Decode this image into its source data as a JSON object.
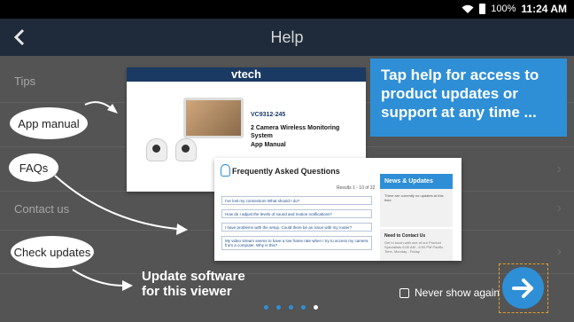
{
  "status": {
    "battery": "100%",
    "time": "11:24 AM"
  },
  "header": {
    "title": "Help"
  },
  "menu": [
    {
      "label": "Tips"
    },
    {
      "label": ""
    },
    {
      "label": ""
    },
    {
      "label": "Contact us"
    },
    {
      "label": ""
    }
  ],
  "callouts": {
    "app_manual": "App manual",
    "faqs": "FAQs",
    "check_updates": "Check updates"
  },
  "banner": {
    "text": "Tap help for access to product updates or support at any time ..."
  },
  "manual_preview": {
    "brand": "vtech",
    "model": "VC9312-245",
    "title": "2 Camera Wireless Monitoring System",
    "subtitle": "App Manual"
  },
  "faq_preview": {
    "title": "Frequently Asked Questions",
    "results": "Results 1 - 10 of 32",
    "questions": [
      "I've lost my connection! What should I do?",
      "How do I adjust the levels of sound and motion notifications?",
      "I have problems with the setup. Could there be an issue with my router?",
      "My video stream seems to have a low frame rate when I try to access my camera from a computer. Why is this?"
    ],
    "news": {
      "heading": "News & Updates",
      "body": "There are currently no updates at this time."
    },
    "contact": {
      "heading": "Need to Contact Us",
      "body": "Get in touch with one of our Product Specialists 6:00 AM - 6:00 PM Pacific Time, Monday - Friday"
    }
  },
  "footer": {
    "update_text": "Update software for this viewer",
    "never_show": "Never show again"
  },
  "pager": {
    "total": 5,
    "active": 5
  },
  "colors": {
    "accent": "#2f8fd6",
    "titlebar": "#1f2a3a"
  }
}
